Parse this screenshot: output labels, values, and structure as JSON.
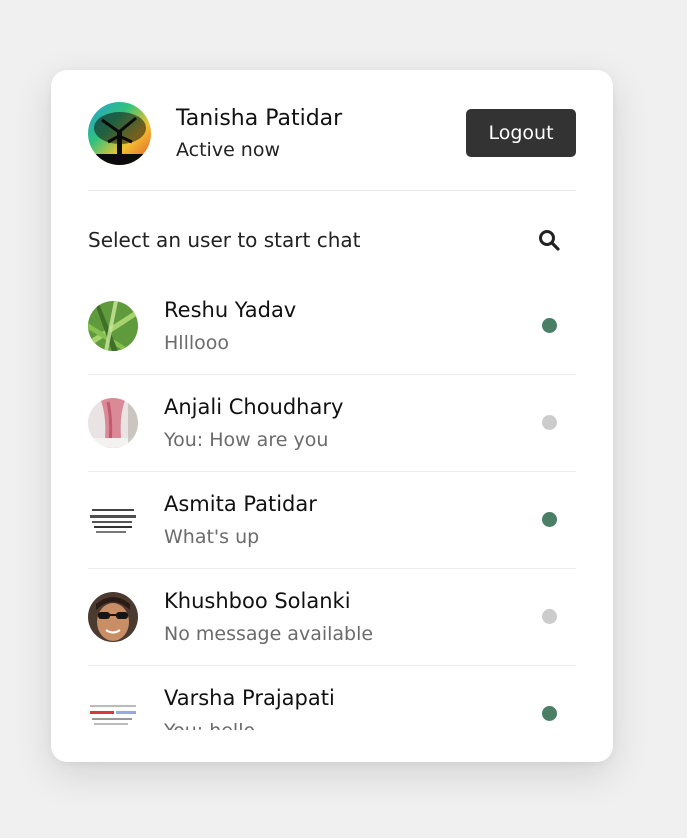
{
  "current_user": {
    "name": "Tanisha Patidar",
    "status": "Active now"
  },
  "header": {
    "logout_label": "Logout"
  },
  "search": {
    "prompt": "Select an user to start chat",
    "icon": "search-icon"
  },
  "colors": {
    "online": "#4a7f66",
    "offline": "#cccccc",
    "button": "#333333"
  },
  "users": [
    {
      "name": "Reshu Yadav",
      "last_message": "Hlllooo",
      "status": "online"
    },
    {
      "name": "Anjali Choudhary",
      "last_message": "You: How are you",
      "status": "offline"
    },
    {
      "name": "Asmita Patidar",
      "last_message": "What's up",
      "status": "online"
    },
    {
      "name": "Khushboo Solanki",
      "last_message": "No message available",
      "status": "offline"
    },
    {
      "name": "Varsha Prajapati",
      "last_message": "You: hello",
      "status": "online"
    }
  ]
}
